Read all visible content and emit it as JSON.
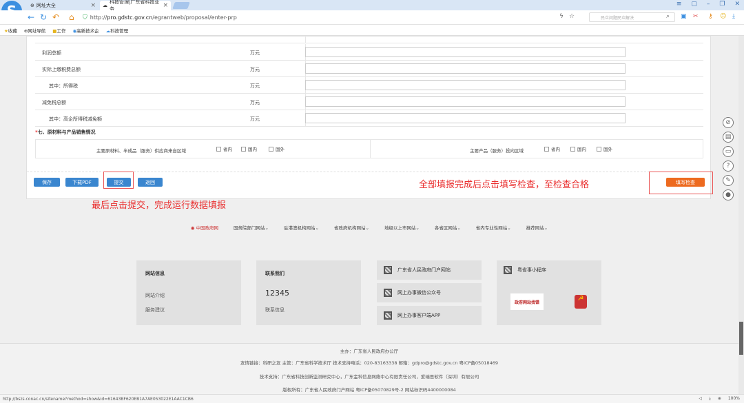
{
  "browser": {
    "tabs": [
      {
        "label": "网址大全"
      },
      {
        "label": "科技管理|广东省科技业务"
      }
    ],
    "url_prefix": "http://",
    "url_host": "pro.gdstc.gov.cn",
    "url_path": "/egrantweb/proposal/enter-prp",
    "search_placeholder": "民众问题民众解决",
    "bookmarks": [
      "收藏",
      "网址导航",
      "工作",
      "高新技术企",
      "科技管理"
    ],
    "status_url": "http://bszs.conac.cn/sitename?method=show&id=61643BF620EB1A7AE053022E1AAC1CB6",
    "zoom": "100%"
  },
  "form": {
    "rows": [
      {
        "label": "利润总额",
        "unit": "万元",
        "indent": false
      },
      {
        "label": "实际上缴税费总额",
        "unit": "万元",
        "indent": false
      },
      {
        "label": "其中：所得税",
        "unit": "万元",
        "indent": true
      },
      {
        "label": "减免税总额",
        "unit": "万元",
        "indent": false
      },
      {
        "label": "其中：高企所得税减免额",
        "unit": "万元",
        "indent": true
      }
    ],
    "section7_star": "*",
    "section7_title": "七、原材料与产品销售情况",
    "source_label": "主要原材料、半成品（服务）供应商来自区域",
    "product_label": "主要产品（服务）投向区域",
    "region_options": [
      "省内",
      "国内",
      "国外"
    ]
  },
  "buttons": {
    "save": "保存",
    "download_pdf": "下载PDF",
    "submit": "提交",
    "back": "返回",
    "check": "填写检查"
  },
  "annotations": {
    "check_note": "全部填报完成后点击填写检查，至检查合格",
    "submit_note": "最后点击提交，完成运行数据填报"
  },
  "footer": {
    "nav": [
      "中国政府网",
      "国务院部门网站",
      "驻港澳机构网站",
      "省政府机构网站",
      "地级以上市网站",
      "各省区网站",
      "省内专业性网站",
      "推荐网站"
    ],
    "site_info": {
      "title": "网站信息",
      "items": [
        "网站介绍",
        "服务建议"
      ]
    },
    "contact": {
      "title": "联系我们",
      "phone": "12345",
      "item": "联系信息"
    },
    "qr_links": [
      "广东省人民政府门户网站",
      "网上办事微信公众号",
      "网上办事客户端APP"
    ],
    "mini": {
      "title": "粤省事小程序",
      "gov_logo": "政府网站找错"
    },
    "host": "主办：广东省人民政府办公厅",
    "links": "友情链接：科研之友    主管：广东省科学技术厅    技术支持电话：020-83163338    邮箱：gdpro@gdstc.gov.cn    粤ICP备05018469",
    "tech": "技术支持：广东省科技创新监测研究中心，广东金科信息网络中心有限责任公司，爱瑞思软件（深圳）有限公司",
    "copyright": "版权所有：广东省人民政府门户网站 粤ICP备05070829号-2 网站标识码4400000084"
  }
}
